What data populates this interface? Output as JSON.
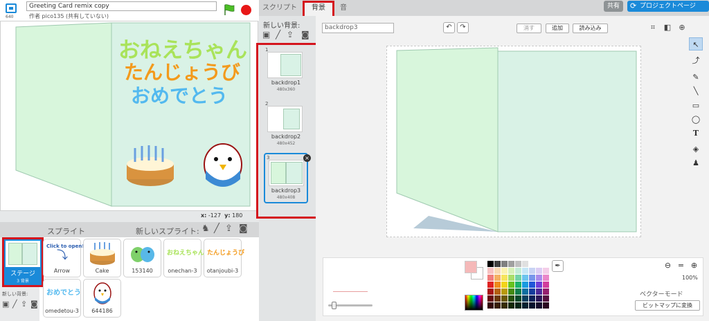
{
  "header": {
    "stage_size_label": "640",
    "project_title": "Greeting Card remix copy",
    "author_line": "作者 pico135 (共有していない)"
  },
  "stage": {
    "text_line1": "おねえちゃん",
    "text_line2": "たんじょうび",
    "text_line3": "おめでとう",
    "mouse_x_label": "x:",
    "mouse_x": "-127",
    "mouse_y_label": "y:",
    "mouse_y": "180"
  },
  "sprites": {
    "label": "スプライト",
    "new_sprite_label": "新しいスプライト:",
    "stage_tile_name": "ステージ",
    "stage_tile_sub": "3 背景",
    "new_backdrop_small": "新しい背景:",
    "arrow_thumb_text": "Click to open!",
    "onechan_thumb_text": "おねえちゃん",
    "otanjoubi_thumb_text": "たんじょうび",
    "omedetou_thumb_text": "おめでとう",
    "items": [
      {
        "name": "Arrow"
      },
      {
        "name": "Cake"
      },
      {
        "name": "153140"
      },
      {
        "name": "onechan-3"
      },
      {
        "name": "otanjoubi-3"
      },
      {
        "name": "omedetou-3"
      },
      {
        "name": "644186"
      }
    ]
  },
  "tabs": {
    "script": "スクリプト",
    "backdrop": "背景",
    "sound": "音"
  },
  "top_right": {
    "share": "共有",
    "project_page": "プロジェクトページ"
  },
  "backdrops": {
    "new_label": "新しい背景:",
    "items": [
      {
        "num": "1",
        "name": "backdrop1",
        "dim": "480x360"
      },
      {
        "num": "2",
        "name": "backdrop2",
        "dim": "480x452"
      },
      {
        "num": "3",
        "name": "backdrop3",
        "dim": "480x408"
      }
    ],
    "delete_glyph": "×"
  },
  "editor": {
    "costume_name": "backdrop3",
    "clear_label": "消す",
    "add_label": "追加",
    "import_label": "読み込み",
    "zoom_level": "100%",
    "vector_mode": "ベクターモード",
    "convert_label": "ビットマップに変換"
  },
  "colors": {
    "accent": "#1a8ad9",
    "highlight_red": "#d4141d",
    "card_green": "#d6f5e1"
  }
}
